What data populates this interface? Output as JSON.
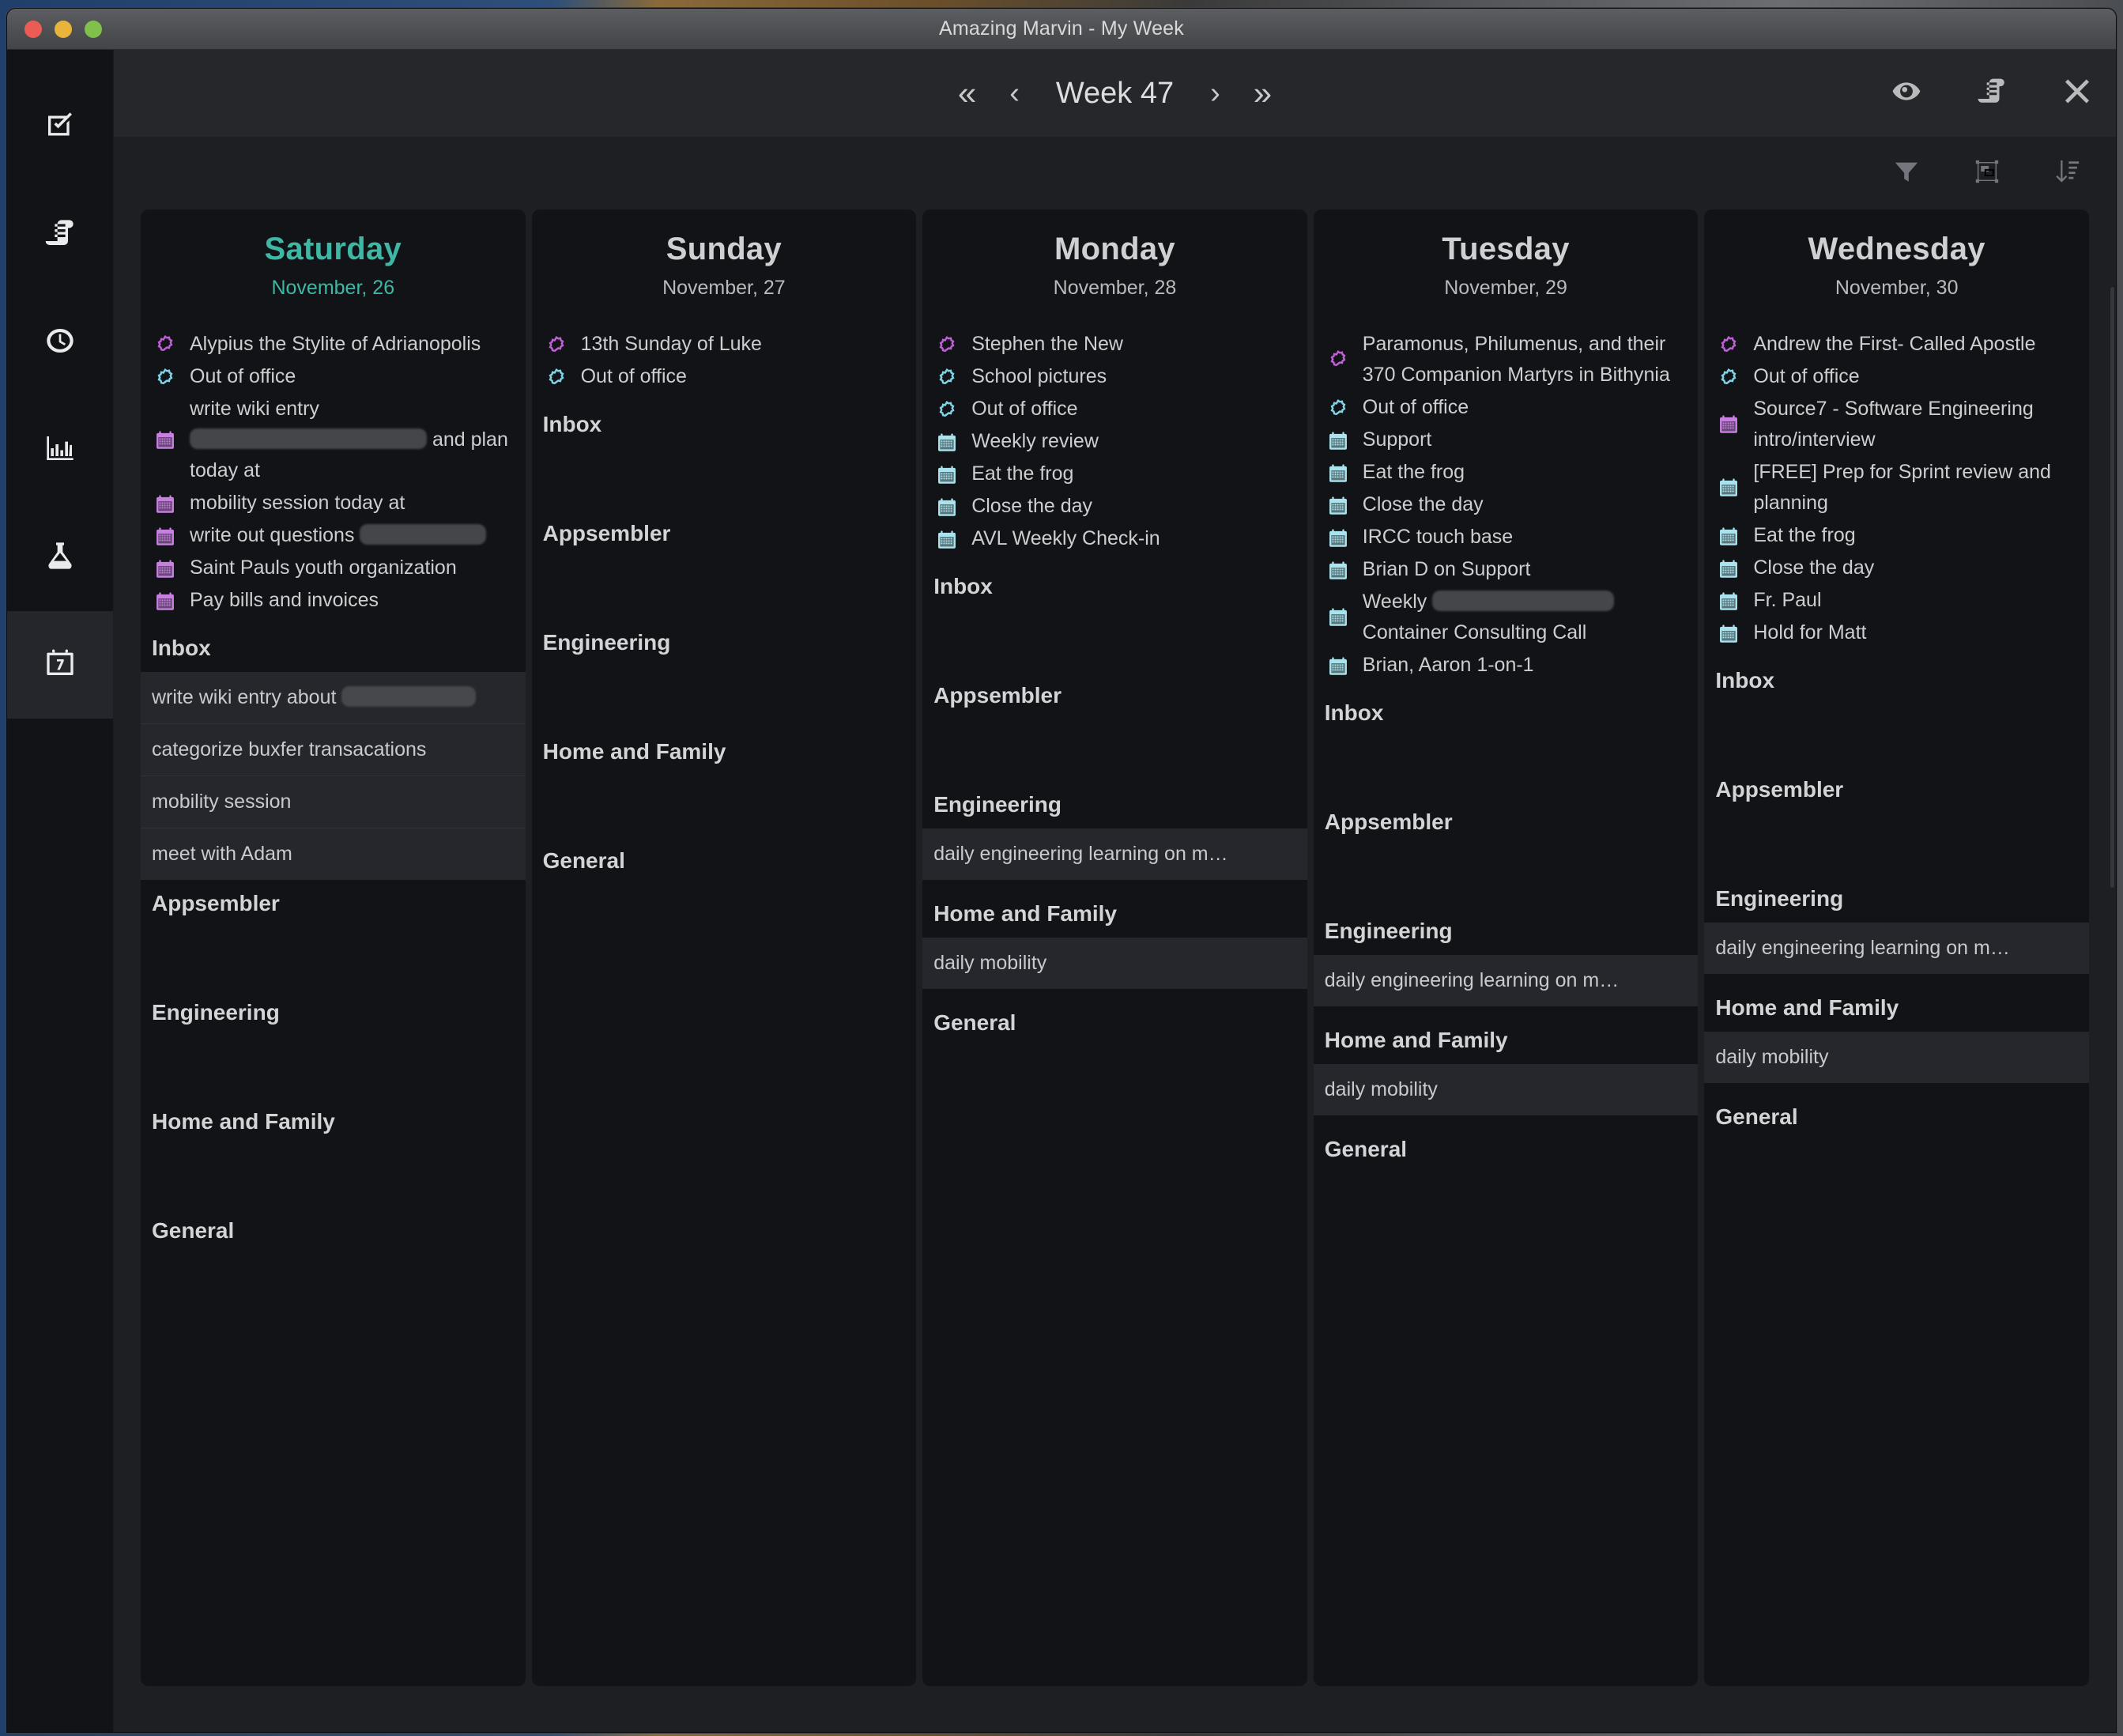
{
  "window": {
    "title": "Amazing Marvin - My Week",
    "traffic_lights": [
      "close",
      "minimize",
      "maximize"
    ]
  },
  "rail": {
    "items": [
      {
        "name": "tasks",
        "icon": "checkbox-icon",
        "active": false
      },
      {
        "name": "notes",
        "icon": "scroll-icon",
        "active": false
      },
      {
        "name": "time",
        "icon": "clock-icon",
        "active": false
      },
      {
        "name": "stats",
        "icon": "bar-chart-icon",
        "active": false
      },
      {
        "name": "lab",
        "icon": "flask-icon",
        "active": false
      },
      {
        "name": "calendar",
        "icon": "calendar-7-icon",
        "active": true
      }
    ]
  },
  "toolbar": {
    "first_label": "«",
    "prev_label": "‹",
    "week_label": "Week 47",
    "next_label": "›",
    "last_label": "»",
    "right_icons": [
      "eye-icon",
      "scroll-icon",
      "close-icon"
    ]
  },
  "subbar": {
    "icons": [
      "filter-icon",
      "group-icon",
      "sort-icon"
    ]
  },
  "colors": {
    "today_accent": "#3eb8a4",
    "calendar_purple": "#c77fe0",
    "calendar_cyan": "#a9e3ee",
    "event_purple": "#c05fd8",
    "event_cyan": "#7fd4e6",
    "task_row_bg": "#25272c",
    "day_bg": "#121316",
    "main_bg": "#1d1f23"
  },
  "days": [
    {
      "name": "Saturday",
      "date": "November, 26",
      "today": true,
      "events": [
        {
          "icon": "sun-icon",
          "color": "purple",
          "text": "Alypius the Stylite of Adrianopolis",
          "multiline": true
        },
        {
          "icon": "sun-icon",
          "color": "cyan",
          "text": "Out of office"
        },
        {
          "icon": "calendar-icon",
          "color": "purple",
          "text": "write wiki entry ",
          "redacted_after": 300,
          "text_tail": "and plan today at",
          "multiline": true
        },
        {
          "icon": "calendar-icon",
          "color": "purple",
          "text": "mobility session today at"
        },
        {
          "icon": "calendar-icon",
          "color": "purple",
          "text": "write out questions ",
          "redacted_after": 160
        },
        {
          "icon": "calendar-icon",
          "color": "purple",
          "text": "Saint Pauls youth organization"
        },
        {
          "icon": "calendar-icon",
          "color": "purple",
          "text": "Pay bills and invoices"
        }
      ],
      "sections": [
        {
          "title": "Inbox",
          "tasks": [
            {
              "text": "write wiki entry about ",
              "redacted_after": 170
            },
            {
              "text": "categorize buxfer transacations"
            },
            {
              "text": "mobility session"
            },
            {
              "text": "meet with Adam"
            }
          ]
        },
        {
          "title": "Appsembler",
          "tasks": []
        },
        {
          "title": "Engineering",
          "tasks": []
        },
        {
          "title": "Home and Family",
          "tasks": []
        },
        {
          "title": "General",
          "tasks": []
        }
      ]
    },
    {
      "name": "Sunday",
      "date": "November, 27",
      "today": false,
      "events": [
        {
          "icon": "sun-icon",
          "color": "purple",
          "text": "13th Sunday of Luke"
        },
        {
          "icon": "sun-icon",
          "color": "cyan",
          "text": "Out of office"
        }
      ],
      "sections": [
        {
          "title": "Inbox",
          "tasks": []
        },
        {
          "title": "Appsembler",
          "tasks": []
        },
        {
          "title": "Engineering",
          "tasks": []
        },
        {
          "title": "Home and Family",
          "tasks": []
        },
        {
          "title": "General",
          "tasks": []
        }
      ]
    },
    {
      "name": "Monday",
      "date": "November, 28",
      "today": false,
      "events": [
        {
          "icon": "sun-icon",
          "color": "purple",
          "text": "Stephen the New"
        },
        {
          "icon": "sun-icon",
          "color": "cyan",
          "text": "School pictures"
        },
        {
          "icon": "sun-icon",
          "color": "cyan",
          "text": "Out of office"
        },
        {
          "icon": "calendar-icon",
          "color": "cyan",
          "text": "Weekly review"
        },
        {
          "icon": "calendar-icon",
          "color": "cyan",
          "text": "Eat the frog"
        },
        {
          "icon": "calendar-icon",
          "color": "cyan",
          "text": "Close the day"
        },
        {
          "icon": "calendar-icon",
          "color": "cyan",
          "text": "AVL Weekly Check-in"
        }
      ],
      "sections": [
        {
          "title": "Inbox",
          "tasks": []
        },
        {
          "title": "Appsembler",
          "tasks": []
        },
        {
          "title": "Engineering",
          "tasks": [
            {
              "text": "daily engineering learning on m…"
            }
          ]
        },
        {
          "title": "Home and Family",
          "tasks": [
            {
              "text": "daily mobility"
            }
          ]
        },
        {
          "title": "General",
          "tasks": []
        }
      ]
    },
    {
      "name": "Tuesday",
      "date": "November, 29",
      "today": false,
      "events": [
        {
          "icon": "sun-icon",
          "color": "purple",
          "text": "Paramonus, Philumenus, and their 370 Companion Martyrs in Bithynia",
          "multiline": true
        },
        {
          "icon": "sun-icon",
          "color": "cyan",
          "text": "Out of office"
        },
        {
          "icon": "calendar-icon",
          "color": "cyan",
          "text": "Support"
        },
        {
          "icon": "calendar-icon",
          "color": "cyan",
          "text": "Eat the frog"
        },
        {
          "icon": "calendar-icon",
          "color": "cyan",
          "text": "Close the day"
        },
        {
          "icon": "calendar-icon",
          "color": "cyan",
          "text": "IRCC touch base"
        },
        {
          "icon": "calendar-icon",
          "color": "cyan",
          "text": "Brian D on Support"
        },
        {
          "icon": "calendar-icon",
          "color": "cyan",
          "text": "Weekly ",
          "redacted_after": 230,
          "text_tail": "Container Consulting Call",
          "multiline": true
        },
        {
          "icon": "calendar-icon",
          "color": "cyan",
          "text": "Brian, Aaron 1-on-1"
        }
      ],
      "sections": [
        {
          "title": "Inbox",
          "tasks": []
        },
        {
          "title": "Appsembler",
          "tasks": []
        },
        {
          "title": "Engineering",
          "tasks": [
            {
              "text": "daily engineering learning on m…"
            }
          ]
        },
        {
          "title": "Home and Family",
          "tasks": [
            {
              "text": "daily mobility"
            }
          ]
        },
        {
          "title": "General",
          "tasks": []
        }
      ]
    },
    {
      "name": "Wednesday",
      "date": "November, 30",
      "today": false,
      "events": [
        {
          "icon": "sun-icon",
          "color": "purple",
          "text": "Andrew the First- Called Apostle"
        },
        {
          "icon": "sun-icon",
          "color": "cyan",
          "text": "Out of office"
        },
        {
          "icon": "calendar-icon",
          "color": "purple",
          "text": "Source7 - Software Engineering intro/interview",
          "multiline": true
        },
        {
          "icon": "calendar-icon",
          "color": "cyan",
          "text": "[FREE] Prep for Sprint review and planning",
          "multiline": true
        },
        {
          "icon": "calendar-icon",
          "color": "cyan",
          "text": "Eat the frog"
        },
        {
          "icon": "calendar-icon",
          "color": "cyan",
          "text": "Close the day"
        },
        {
          "icon": "calendar-icon",
          "color": "cyan",
          "text": "Fr. Paul"
        },
        {
          "icon": "calendar-icon",
          "color": "cyan",
          "text": "Hold for Matt"
        }
      ],
      "sections": [
        {
          "title": "Inbox",
          "tasks": []
        },
        {
          "title": "Appsembler",
          "tasks": []
        },
        {
          "title": "Engineering",
          "tasks": [
            {
              "text": "daily engineering learning on m…"
            }
          ]
        },
        {
          "title": "Home and Family",
          "tasks": [
            {
              "text": "daily mobility"
            }
          ]
        },
        {
          "title": "General",
          "tasks": []
        }
      ]
    }
  ]
}
